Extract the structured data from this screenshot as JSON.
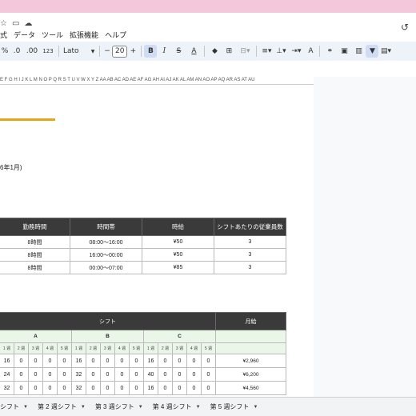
{
  "colors": {
    "accent_pink": "#f5c7da",
    "header_dark": "#3a3a3a",
    "header_green": "#eaf6e8",
    "underline_orange": "#e8a317"
  },
  "title_icons": [
    "star-icon",
    "folder-move-icon",
    "cloud-status-icon"
  ],
  "menu": [
    "式",
    "データ",
    "ツール",
    "拡張機能",
    "ヘルプ"
  ],
  "toolbar": {
    "percent": "%",
    "dec_decrease": ".0",
    "dec_increase": ".00",
    "number_format": "123",
    "font": "Lato",
    "font_size": "20",
    "minus": "−",
    "plus": "+",
    "bold": "B",
    "italic": "I",
    "strike": "S",
    "text_color": "A",
    "text_color2": "A"
  },
  "column_header": "E F G H I J K L M N O P Q R S T U V W X Y Z AA AB AC AD AE AF AG AH AI AJ AK AL AM AN AO AP AQ AR AS AT AU",
  "subtitle": "6年1月)",
  "table1": {
    "headers": [
      "勤務時間",
      "時間帯",
      "時給",
      "シフトあたりの従業員数"
    ],
    "rows": [
      [
        "8時間",
        "08:00～16:00",
        "¥50",
        "3"
      ],
      [
        "8時間",
        "16:00～00:00",
        "¥50",
        "3"
      ],
      [
        "8時間",
        "00:00～07:00",
        "¥85",
        "3"
      ]
    ]
  },
  "table2": {
    "shift_header": "シフト",
    "pay_header": "月給",
    "groups": [
      "A",
      "B",
      "C"
    ],
    "week_labels": [
      "1 週",
      "2 週",
      "3 週",
      "4 週",
      "5 週"
    ],
    "rows": [
      {
        "a": [
          "16",
          "0",
          "0",
          "0",
          "0"
        ],
        "b": [
          "16",
          "0",
          "0",
          "0",
          "0"
        ],
        "c": [
          "16",
          "0",
          "0",
          "0",
          "0"
        ],
        "pay": "¥2,960"
      },
      {
        "a": [
          "24",
          "0",
          "0",
          "0",
          "0"
        ],
        "b": [
          "32",
          "0",
          "0",
          "0",
          "0"
        ],
        "c": [
          "40",
          "0",
          "0",
          "0",
          "0"
        ],
        "pay": "¥6,200"
      },
      {
        "a": [
          "32",
          "0",
          "0",
          "0",
          "0"
        ],
        "b": [
          "32",
          "0",
          "0",
          "0",
          "0"
        ],
        "c": [
          "16",
          "0",
          "0",
          "0",
          "0"
        ],
        "pay": "¥4,560"
      }
    ]
  },
  "sheet_tabs": [
    "シフト",
    "第 2 週シフト",
    "第 3 週シフト",
    "第 4 週シフト",
    "第 5 週シフト"
  ]
}
